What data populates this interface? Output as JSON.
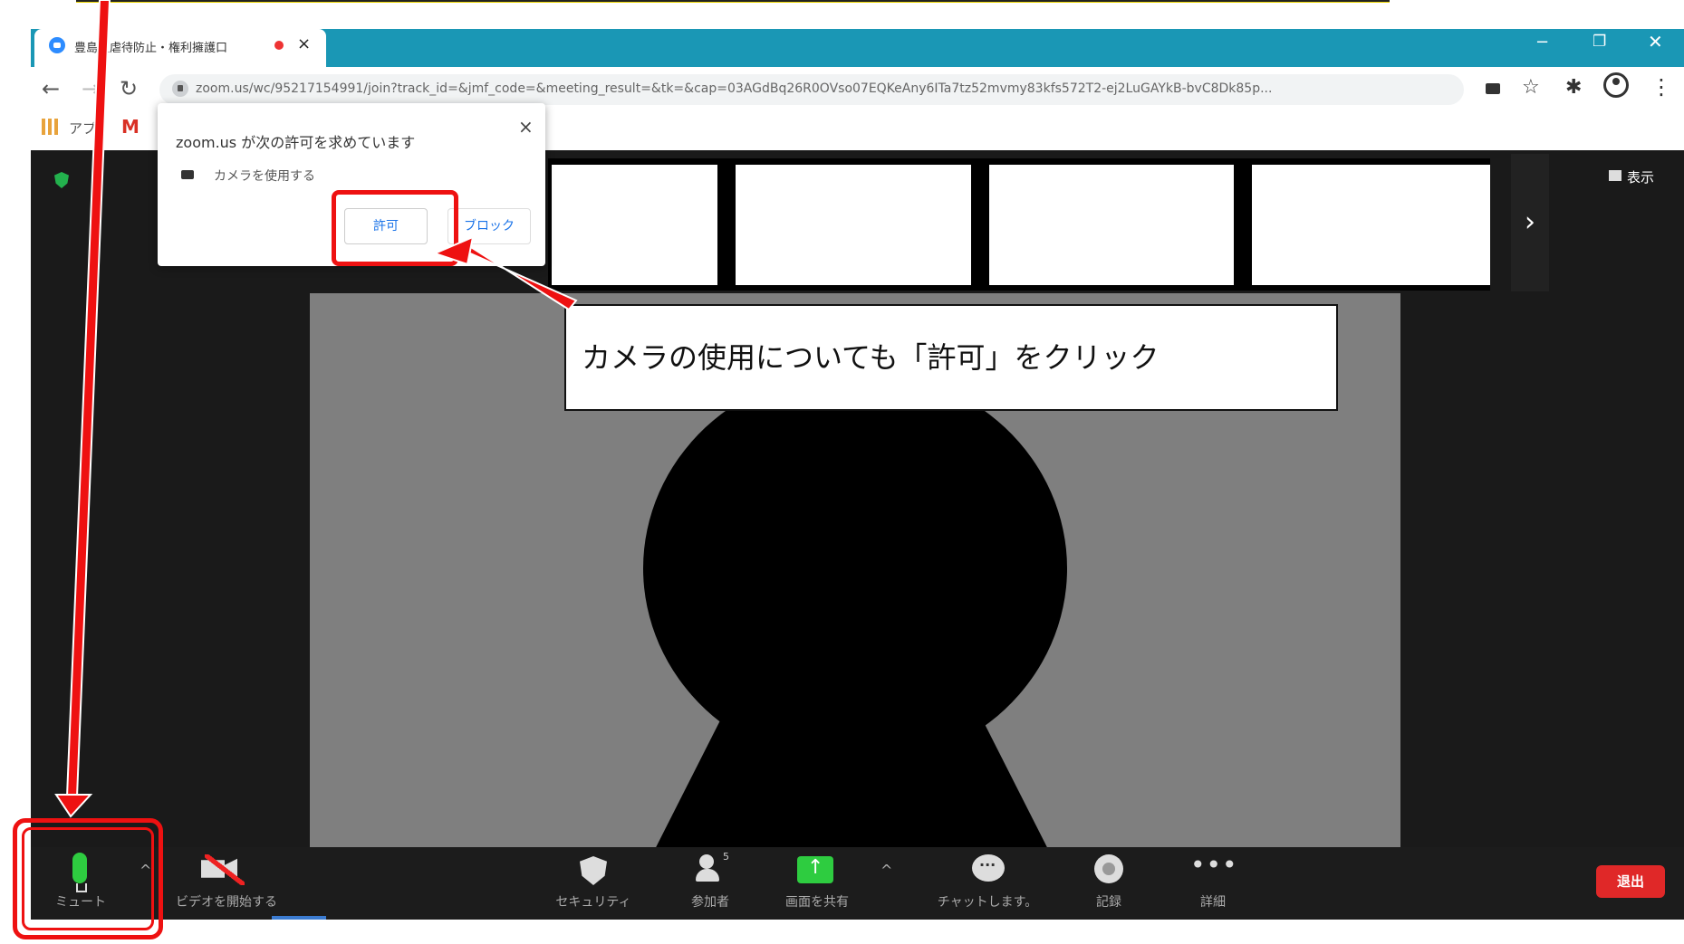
{
  "browser": {
    "tab_title": "豊島区虐待防止・権利擁護口",
    "tab_close": "×",
    "window_controls": {
      "minimize": "−",
      "restore": "❐",
      "close": "✕"
    },
    "url": "zoom.us/wc/95217154991/join?track_id=&jmf_code=&meeting_result=&tk=&cap=03AGdBq26R0OVso07EQKeAny6ITa7tz52mvmy83kfs572T2-ej2LuGAYkB-bvC8Dk85p...",
    "bookmarks": {
      "apps_label": "アプ",
      "gmail_label": "M"
    }
  },
  "permission_popup": {
    "title": "zoom.us が次の許可を求めています",
    "item": "カメラを使用する",
    "allow_label": "許可",
    "block_label": "ブロック",
    "close_label": "×"
  },
  "callout": {
    "text": "カメラの使用についても「許可」をクリック"
  },
  "meeting": {
    "view_label": "表示",
    "next_arrow": "›"
  },
  "controls": {
    "mute_label": "ミュート",
    "video_label": "ビデオを開始する",
    "security_label": "セキュリティ",
    "participants_label": "参加者",
    "participants_count": "5",
    "share_label": "画面を共有",
    "chat_label": "チャットします。",
    "record_label": "記録",
    "more_label": "詳細",
    "more_dots": "•••",
    "leave_label": "退出",
    "caret": "^"
  },
  "colors": {
    "tabbar": "#1a97b5",
    "annotation_red": "#e11111",
    "zoom_green": "#2ecc40",
    "leave_red": "#e02828",
    "video_gray": "#7f7f7f"
  }
}
